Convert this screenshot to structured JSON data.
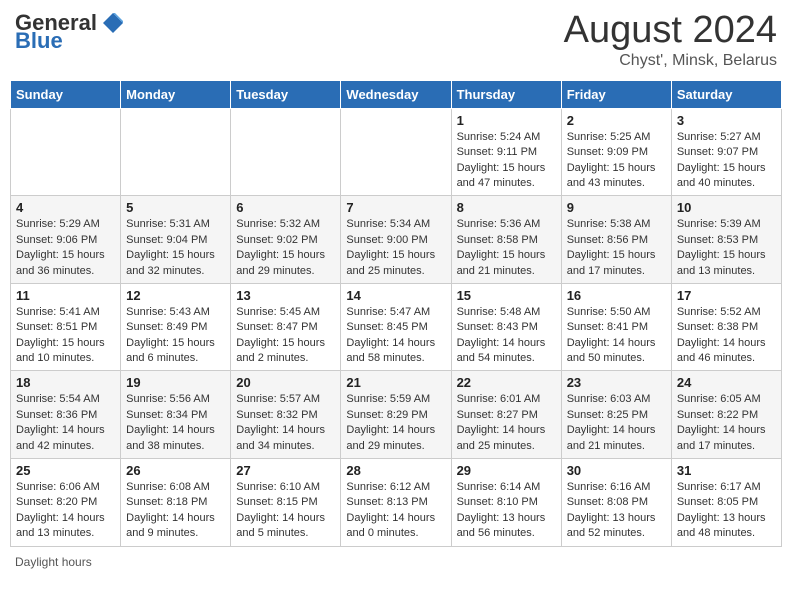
{
  "header": {
    "logo_general": "General",
    "logo_blue": "Blue",
    "month_title": "August 2024",
    "subtitle": "Chyst', Minsk, Belarus"
  },
  "weekdays": [
    "Sunday",
    "Monday",
    "Tuesday",
    "Wednesday",
    "Thursday",
    "Friday",
    "Saturday"
  ],
  "footer": {
    "daylight_label": "Daylight hours"
  },
  "weeks": [
    [
      {
        "day": "",
        "info": ""
      },
      {
        "day": "",
        "info": ""
      },
      {
        "day": "",
        "info": ""
      },
      {
        "day": "",
        "info": ""
      },
      {
        "day": "1",
        "info": "Sunrise: 5:24 AM\nSunset: 9:11 PM\nDaylight: 15 hours\nand 47 minutes."
      },
      {
        "day": "2",
        "info": "Sunrise: 5:25 AM\nSunset: 9:09 PM\nDaylight: 15 hours\nand 43 minutes."
      },
      {
        "day": "3",
        "info": "Sunrise: 5:27 AM\nSunset: 9:07 PM\nDaylight: 15 hours\nand 40 minutes."
      }
    ],
    [
      {
        "day": "4",
        "info": "Sunrise: 5:29 AM\nSunset: 9:06 PM\nDaylight: 15 hours\nand 36 minutes."
      },
      {
        "day": "5",
        "info": "Sunrise: 5:31 AM\nSunset: 9:04 PM\nDaylight: 15 hours\nand 32 minutes."
      },
      {
        "day": "6",
        "info": "Sunrise: 5:32 AM\nSunset: 9:02 PM\nDaylight: 15 hours\nand 29 minutes."
      },
      {
        "day": "7",
        "info": "Sunrise: 5:34 AM\nSunset: 9:00 PM\nDaylight: 15 hours\nand 25 minutes."
      },
      {
        "day": "8",
        "info": "Sunrise: 5:36 AM\nSunset: 8:58 PM\nDaylight: 15 hours\nand 21 minutes."
      },
      {
        "day": "9",
        "info": "Sunrise: 5:38 AM\nSunset: 8:56 PM\nDaylight: 15 hours\nand 17 minutes."
      },
      {
        "day": "10",
        "info": "Sunrise: 5:39 AM\nSunset: 8:53 PM\nDaylight: 15 hours\nand 13 minutes."
      }
    ],
    [
      {
        "day": "11",
        "info": "Sunrise: 5:41 AM\nSunset: 8:51 PM\nDaylight: 15 hours\nand 10 minutes."
      },
      {
        "day": "12",
        "info": "Sunrise: 5:43 AM\nSunset: 8:49 PM\nDaylight: 15 hours\nand 6 minutes."
      },
      {
        "day": "13",
        "info": "Sunrise: 5:45 AM\nSunset: 8:47 PM\nDaylight: 15 hours\nand 2 minutes."
      },
      {
        "day": "14",
        "info": "Sunrise: 5:47 AM\nSunset: 8:45 PM\nDaylight: 14 hours\nand 58 minutes."
      },
      {
        "day": "15",
        "info": "Sunrise: 5:48 AM\nSunset: 8:43 PM\nDaylight: 14 hours\nand 54 minutes."
      },
      {
        "day": "16",
        "info": "Sunrise: 5:50 AM\nSunset: 8:41 PM\nDaylight: 14 hours\nand 50 minutes."
      },
      {
        "day": "17",
        "info": "Sunrise: 5:52 AM\nSunset: 8:38 PM\nDaylight: 14 hours\nand 46 minutes."
      }
    ],
    [
      {
        "day": "18",
        "info": "Sunrise: 5:54 AM\nSunset: 8:36 PM\nDaylight: 14 hours\nand 42 minutes."
      },
      {
        "day": "19",
        "info": "Sunrise: 5:56 AM\nSunset: 8:34 PM\nDaylight: 14 hours\nand 38 minutes."
      },
      {
        "day": "20",
        "info": "Sunrise: 5:57 AM\nSunset: 8:32 PM\nDaylight: 14 hours\nand 34 minutes."
      },
      {
        "day": "21",
        "info": "Sunrise: 5:59 AM\nSunset: 8:29 PM\nDaylight: 14 hours\nand 29 minutes."
      },
      {
        "day": "22",
        "info": "Sunrise: 6:01 AM\nSunset: 8:27 PM\nDaylight: 14 hours\nand 25 minutes."
      },
      {
        "day": "23",
        "info": "Sunrise: 6:03 AM\nSunset: 8:25 PM\nDaylight: 14 hours\nand 21 minutes."
      },
      {
        "day": "24",
        "info": "Sunrise: 6:05 AM\nSunset: 8:22 PM\nDaylight: 14 hours\nand 17 minutes."
      }
    ],
    [
      {
        "day": "25",
        "info": "Sunrise: 6:06 AM\nSunset: 8:20 PM\nDaylight: 14 hours\nand 13 minutes."
      },
      {
        "day": "26",
        "info": "Sunrise: 6:08 AM\nSunset: 8:18 PM\nDaylight: 14 hours\nand 9 minutes."
      },
      {
        "day": "27",
        "info": "Sunrise: 6:10 AM\nSunset: 8:15 PM\nDaylight: 14 hours\nand 5 minutes."
      },
      {
        "day": "28",
        "info": "Sunrise: 6:12 AM\nSunset: 8:13 PM\nDaylight: 14 hours\nand 0 minutes."
      },
      {
        "day": "29",
        "info": "Sunrise: 6:14 AM\nSunset: 8:10 PM\nDaylight: 13 hours\nand 56 minutes."
      },
      {
        "day": "30",
        "info": "Sunrise: 6:16 AM\nSunset: 8:08 PM\nDaylight: 13 hours\nand 52 minutes."
      },
      {
        "day": "31",
        "info": "Sunrise: 6:17 AM\nSunset: 8:05 PM\nDaylight: 13 hours\nand 48 minutes."
      }
    ]
  ]
}
